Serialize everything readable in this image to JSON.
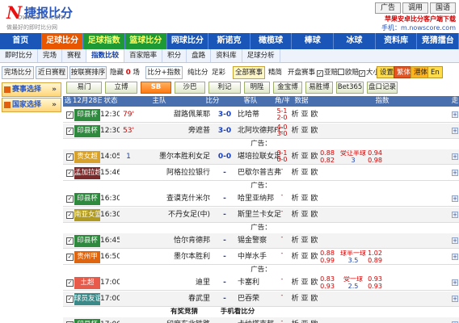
{
  "header": {
    "logo_mark": "N",
    "logo_cn": "捷报比分",
    "logo_domain": "owscore.com",
    "slogan": "做最好的即时比分网",
    "buttons": [
      "广告",
      "调用",
      "国语"
    ],
    "app_tip": "苹果安卓比分客户端下载",
    "mobile": "手机：m.nowscore.com"
  },
  "nav": {
    "items": [
      {
        "label": "首页",
        "style": "blue"
      },
      {
        "label": "足球比分",
        "style": "active"
      },
      {
        "label": "足球指数",
        "style": "green"
      },
      {
        "label": "篮球比分",
        "style": "green"
      },
      {
        "label": "网球比分",
        "style": "blue"
      },
      {
        "label": "斯诺克",
        "style": "blue"
      },
      {
        "label": "橄榄球",
        "style": "blue"
      },
      {
        "label": "棒球",
        "style": "blue"
      },
      {
        "label": "冰球",
        "style": "blue"
      },
      {
        "label": "资料库",
        "style": "blue"
      },
      {
        "label": "竞猜擂台",
        "style": "blue"
      }
    ]
  },
  "subnav": {
    "items": [
      "即时比分",
      "完场",
      "赛程",
      "指数比较",
      "百家赔率",
      "积分",
      "盘路",
      "资料库",
      "足球分析"
    ],
    "selected": 3
  },
  "toolbar1": {
    "finished": "完场比分",
    "recent": "近日赛程",
    "league_sort": "按联赛排序",
    "hidden_label": "隐藏",
    "hidden_count": "0",
    "hidden_unit": "场",
    "score_index": "比分+指数",
    "pure_score": "纯比分",
    "football": "足彩",
    "all_matches": "全部赛事",
    "simplified": "精简",
    "open_match": "开盘赛事",
    "asia_label": "亚赔",
    "euro_label": "欧赔",
    "size_label": "大小",
    "btn_settings": "设置",
    "btn_trad": "繁体",
    "btn_hk": "港体",
    "btn_en": "En"
  },
  "sidebar": {
    "items": [
      "赛事选择",
      "国家选择"
    ]
  },
  "toolbar2": {
    "items": [
      "易门",
      "立博",
      "SB",
      "沙巴",
      "利记",
      "明陞",
      "金宝博",
      "易胜博",
      "Bet365",
      "盘口记录"
    ],
    "active": 2
  },
  "table": {
    "headers": [
      "选",
      "12月28日",
      "状态",
      "主队",
      "比分",
      "客队",
      "角/半",
      "数据",
      "指数",
      "走"
    ],
    "rows": [
      {
        "type": "match",
        "league": "印县杯",
        "league_color": "#2e8b3e",
        "time": "12:30",
        "status": "79'",
        "status_color": "red",
        "home": "甜路佩莱耶",
        "score": "3-0",
        "away": "比哈蒂",
        "corner_half": [
          "5-1",
          "2-0"
        ],
        "data": "析 亚 欧",
        "odds": [],
        "checked": true
      },
      {
        "type": "match",
        "league": "印县杯",
        "league_color": "#2e8b3e",
        "time": "12:30",
        "status": "53'",
        "status_color": "red",
        "home": "旁遮普",
        "score": "3-0",
        "away": "北阿坎德邦FC",
        "corner_half": [
          "4-0",
          "3-0"
        ],
        "data": "析 亚 欧",
        "odds": [],
        "checked": true
      },
      {
        "type": "ad",
        "text": "广告："
      },
      {
        "type": "match",
        "league": "贵女超",
        "league_color": "#d7a12a",
        "time": "14:05",
        "status": "1",
        "status_color": "blue",
        "home": "墨尔本胜利女足",
        "score": "0-0",
        "away": "堪培拉联女足",
        "corner_half": [
          "0-1",
          "0-0"
        ],
        "data": "析 亚 欧",
        "odds": [
          [
            "0.88",
            "0.82"
          ],
          [
            "受让半球",
            "3"
          ],
          [
            "0.94",
            "0.98"
          ]
        ],
        "checked": true
      },
      {
        "type": "match",
        "league": "孟加拉超",
        "league_color": "#7a2a2a",
        "time": "15:46",
        "status": "",
        "status_color": "blue",
        "home": "阿格拉拉银行",
        "score": "-",
        "away": "巴歇尔普吉弗",
        "corner_half": [
          "-",
          ""
        ],
        "data": "析 亚 欧",
        "odds": [],
        "checked": true
      },
      {
        "type": "ad",
        "text": "广告："
      },
      {
        "type": "match",
        "league": "印县杯",
        "league_color": "#2e8b3e",
        "time": "16:30",
        "status": "",
        "status_color": "blue",
        "home": "查谟克什米尔",
        "score": "-",
        "away": "哈里亚纳邦",
        "corner_half": [
          "-",
          ""
        ],
        "data": "析 亚 欧",
        "odds": [],
        "checked": true
      },
      {
        "type": "match",
        "league": "南亚女篮",
        "league_color": "#b09a20",
        "time": "16:30",
        "status": "",
        "status_color": "blue",
        "home": "不丹女足(中)",
        "score": "-",
        "away": "斯里兰卡女足",
        "corner_half": [
          "-",
          ""
        ],
        "data": "析 亚 欧",
        "odds": [],
        "checked": true
      },
      {
        "type": "ad",
        "text": "广告："
      },
      {
        "type": "match",
        "league": "印县杯",
        "league_color": "#2e8b3e",
        "time": "16:45",
        "status": "",
        "status_color": "blue",
        "home": "恰尔肯德邦",
        "score": "-",
        "away": "锡金警察",
        "corner_half": [
          "-",
          ""
        ],
        "data": "析 亚 欧",
        "odds": [],
        "checked": true
      },
      {
        "type": "match",
        "league": "贵州甲",
        "league_color": "#e0650f",
        "time": "16:50",
        "status": "",
        "status_color": "blue",
        "home": "墨尔本胜利",
        "score": "-",
        "away": "中岸水手",
        "corner_half": [
          "-",
          ""
        ],
        "data": "析 亚 欧",
        "odds": [
          [
            "0.88",
            "0.99"
          ],
          [
            "球半一球",
            "3.5"
          ],
          [
            "1.02",
            "0.89"
          ]
        ],
        "checked": true
      },
      {
        "type": "ad",
        "text": "广告："
      },
      {
        "type": "match",
        "league": "土超",
        "league_color": "#e85a4a",
        "time": "17:00",
        "status": "",
        "status_color": "blue",
        "home": "迪里",
        "score": "-",
        "away": "卡塞利",
        "corner_half": [
          "-",
          ""
        ],
        "data": "析 亚 欧",
        "odds": [
          [
            "0.83",
            "0.93"
          ],
          [
            "受一球",
            "2.5"
          ],
          [
            "0.93",
            "0.93"
          ]
        ],
        "checked": true
      },
      {
        "type": "match",
        "league": "球员友谊",
        "league_color": "#3a8a8a",
        "time": "17:00",
        "status": "",
        "status_color": "blue",
        "home": "春武里",
        "score": "-",
        "away": "巴吞荣",
        "corner_half": [
          "-",
          ""
        ],
        "data": "析 亚 欧",
        "odds": [],
        "checked": true
      },
      {
        "type": "promo",
        "left": "有奖竞猜",
        "right": "手机看比分"
      },
      {
        "type": "match",
        "league": "印县杯",
        "league_color": "#2e8b3e",
        "time": "17:00",
        "status": "",
        "status_color": "blue",
        "home": "印度东北铁路",
        "score": "-",
        "away": "卡纳塔克邦",
        "corner_half": [
          "-",
          ""
        ],
        "data": "析 亚 欧",
        "odds": [],
        "checked": true
      }
    ]
  }
}
